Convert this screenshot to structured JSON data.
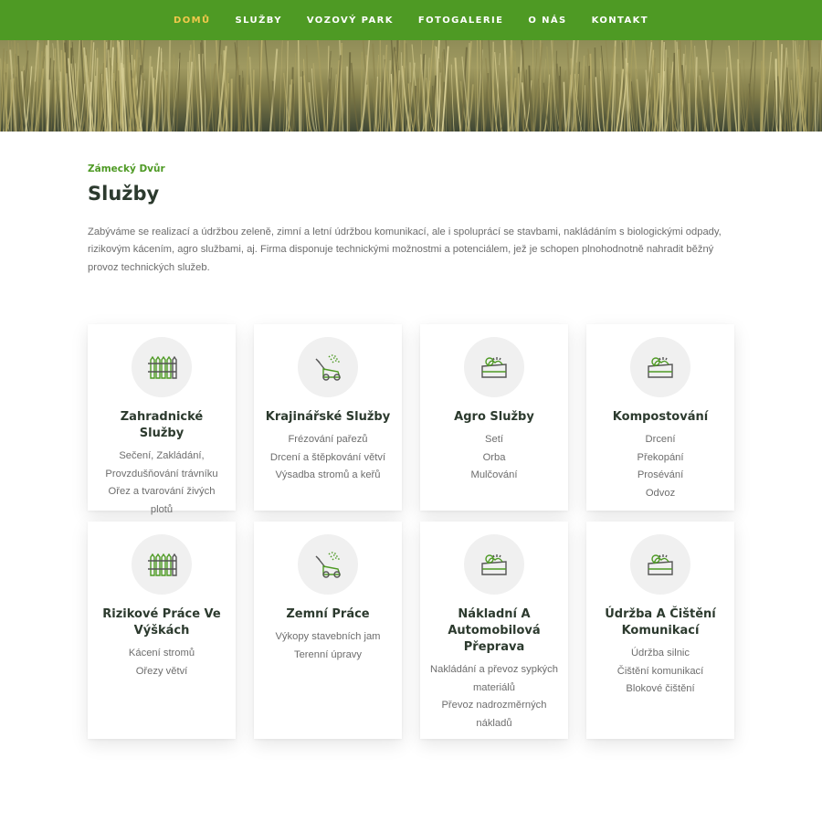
{
  "nav": {
    "items": [
      {
        "label": "DOMŮ",
        "active": true
      },
      {
        "label": "SLUŽBY",
        "active": false
      },
      {
        "label": "VOZOVÝ PARK",
        "active": false
      },
      {
        "label": "FOTOGALERIE",
        "active": false
      },
      {
        "label": "O NÁS",
        "active": false
      },
      {
        "label": "KONTAKT",
        "active": false
      }
    ]
  },
  "colors": {
    "brand_green": "#4e9a24",
    "nav_active": "#f2c94c",
    "heading": "#2c3a2e",
    "body_text": "#6d6d6d"
  },
  "header": {
    "subtitle": "Zámecký Dvůr",
    "title": "Služby",
    "intro": "Zabýváme se realizací a údržbou zeleně, zimní a letní údržbou komunikací, ale i spoluprácí se stavbami, nakládáním s biologickými odpady, rizikovým kácením, agro službami, aj. Firma disponuje technickými možnostmi a potenciálem, jež je schopen plnohodnotně nahradit běžný provoz technických služeb."
  },
  "services": [
    {
      "icon": "fence-icon",
      "title": "Zahradnické Služby",
      "items": [
        "Sečení, Zakládání,",
        "Provzdušňování trávníku",
        "Ořez a tvarování živých plotů"
      ]
    },
    {
      "icon": "lawn-mower-icon",
      "title": "Krajinářské Služby",
      "items": [
        "Frézování pařezů",
        "Drcení a štěpkování větví",
        "Výsadba stromů a keřů"
      ]
    },
    {
      "icon": "garden-planter-icon",
      "title": "Agro Služby",
      "items": [
        "Setí",
        "Orba",
        "Mulčování"
      ]
    },
    {
      "icon": "garden-planter-icon",
      "title": "Kompostování",
      "items": [
        "Drcení",
        "Překopání",
        "Prosévání",
        "Odvoz"
      ]
    },
    {
      "icon": "fence-icon",
      "title": "Rizikové Práce Ve Výškách",
      "items": [
        "Kácení stromů",
        "Ořezy větví"
      ]
    },
    {
      "icon": "lawn-mower-icon",
      "title": "Zemní Práce",
      "items": [
        "Výkopy stavebních jam",
        "Terenní úpravy"
      ]
    },
    {
      "icon": "garden-planter-icon",
      "title": "Nákladní A Automobilová Přeprava",
      "items": [
        "Nakládání a převoz sypkých materiálů",
        "Převoz nadrozměrných nákladů"
      ]
    },
    {
      "icon": "garden-planter-icon",
      "title": "Údržba A Čištění Komunikací",
      "items": [
        "Údržba silnic",
        "Čištění komunikací",
        "Blokové čištění"
      ]
    }
  ]
}
